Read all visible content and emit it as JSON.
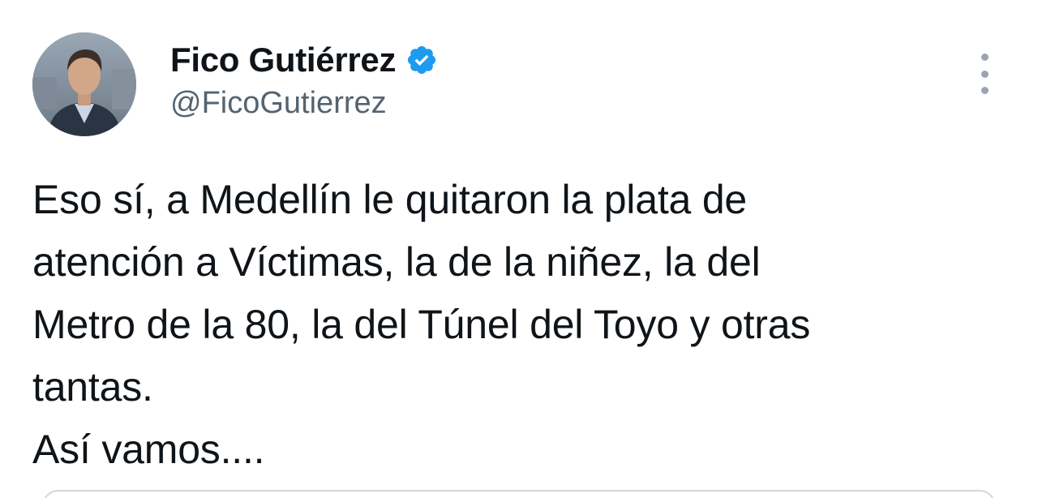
{
  "tweet": {
    "author": {
      "name": "Fico Gutiérrez",
      "handle": "@FicoGutierrez",
      "verified_icon": "verified-badge-icon",
      "verified_color": "#1d9bf0"
    },
    "more_icon": "more-vertical-icon",
    "text_lines": [
      "Eso sí, a Medellín le quitaron la plata de",
      "atención a Víctimas, la de la niñez, la del",
      "Metro de la 80, la del Túnel del Toyo y otras",
      "tantas.",
      "Así vamos...."
    ]
  }
}
